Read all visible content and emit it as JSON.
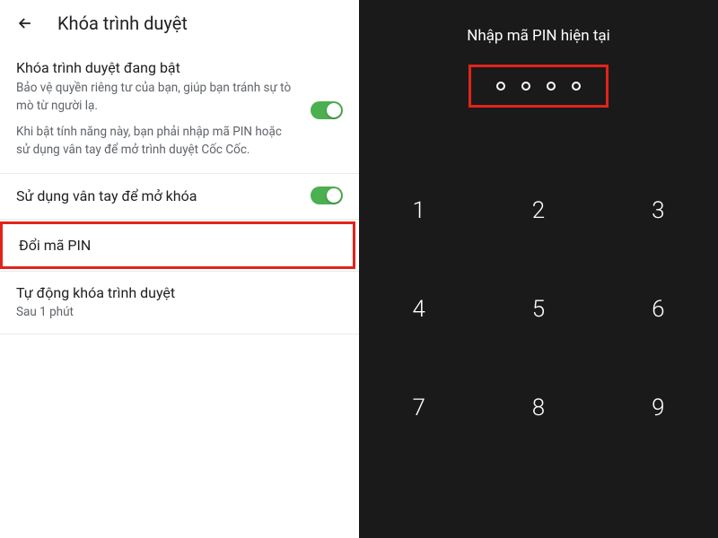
{
  "settings": {
    "title": "Khóa trình duyệt",
    "lockSection": {
      "title": "Khóa trình duyệt đang bật",
      "desc1": "Bảo vệ quyền riêng tư của bạn, giúp bạn tránh sự tò mò từ người lạ.",
      "desc2": "Khi bật tính năng này, bạn phải nhập mã PIN hoặc sử dụng vân tay để mở trình duyệt Cốc Cốc."
    },
    "fingerprint": {
      "label": "Sử dụng vân tay để mở khóa"
    },
    "changePin": {
      "label": "Đổi mã PIN"
    },
    "autoLock": {
      "label": "Tự động khóa trình duyệt",
      "value": "Sau 1 phút"
    }
  },
  "pinScreen": {
    "title": "Nhập mã PIN hiện tại",
    "keys": [
      "1",
      "2",
      "3",
      "4",
      "5",
      "6",
      "7",
      "8",
      "9"
    ]
  }
}
